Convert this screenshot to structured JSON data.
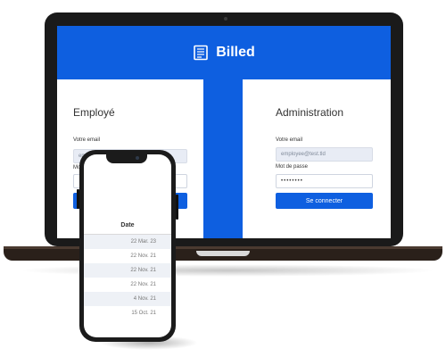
{
  "app": {
    "brand": "Billed",
    "accent": "#0e5fe0"
  },
  "employee": {
    "title": "Employé",
    "email_label": "Votre email",
    "email_value": "em",
    "password_label": "Mo"
  },
  "admin": {
    "title": "Administration",
    "email_label": "Votre email",
    "email_value": "employee@test.tld",
    "password_label": "Mot de passe",
    "password_value": "••••••••",
    "submit_label": "Se connecter"
  },
  "phone": {
    "column_header": "Date",
    "rows": [
      "22 Mar. 23",
      "22 Nov. 21",
      "22 Nov. 21",
      "22 Nov. 21",
      "4 Nov. 21",
      "15 Oct. 21"
    ]
  }
}
